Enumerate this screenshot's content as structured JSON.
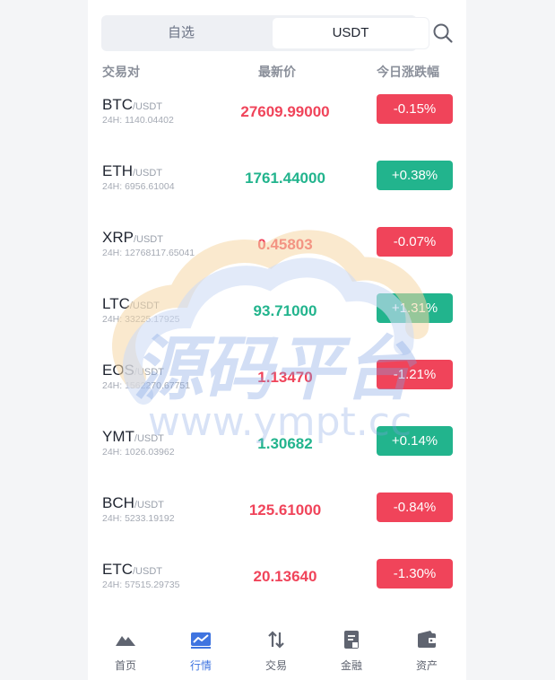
{
  "tabs": {
    "favorites": "自选",
    "usdt": "USDT",
    "active": "usdt"
  },
  "header": {
    "pair": "交易对",
    "price": "最新价",
    "change": "今日涨跌幅"
  },
  "rows": [
    {
      "base": "BTC",
      "quote": "/USDT",
      "volume": "24H: 1140.04402",
      "price": "27609.99000",
      "change": "-0.15%",
      "trend": "down"
    },
    {
      "base": "ETH",
      "quote": "/USDT",
      "volume": "24H: 6956.61004",
      "price": "1761.44000",
      "change": "+0.38%",
      "trend": "up"
    },
    {
      "base": "XRP",
      "quote": "/USDT",
      "volume": "24H: 12768117.65041",
      "price": "0.45803",
      "change": "-0.07%",
      "trend": "down"
    },
    {
      "base": "LTC",
      "quote": "/USDT",
      "volume": "24H: 33225.17925",
      "price": "93.71000",
      "change": "+1.31%",
      "trend": "up"
    },
    {
      "base": "EOS",
      "quote": "/USDT",
      "volume": "24H: 1562270.67751",
      "price": "1.13470",
      "change": "-1.21%",
      "trend": "down"
    },
    {
      "base": "YMT",
      "quote": "/USDT",
      "volume": "24H: 1026.03962",
      "price": "1.30682",
      "change": "+0.14%",
      "trend": "up"
    },
    {
      "base": "BCH",
      "quote": "/USDT",
      "volume": "24H: 5233.19192",
      "price": "125.61000",
      "change": "-0.84%",
      "trend": "down"
    },
    {
      "base": "ETC",
      "quote": "/USDT",
      "volume": "24H: 57515.29735",
      "price": "20.13640",
      "change": "-1.30%",
      "trend": "down"
    }
  ],
  "watermark": {
    "title": "源码平台",
    "url": "www.ympt.cc"
  },
  "nav": [
    {
      "label": "首页",
      "icon": "home-mountain-icon",
      "active": false
    },
    {
      "label": "行情",
      "icon": "market-chart-icon",
      "active": true
    },
    {
      "label": "交易",
      "icon": "trade-arrows-icon",
      "active": false
    },
    {
      "label": "金融",
      "icon": "finance-doc-icon",
      "active": false
    },
    {
      "label": "资产",
      "icon": "wallet-icon",
      "active": false
    }
  ],
  "colors": {
    "up": "#22b48d",
    "down": "#f0445a",
    "accent": "#3f74e0"
  }
}
